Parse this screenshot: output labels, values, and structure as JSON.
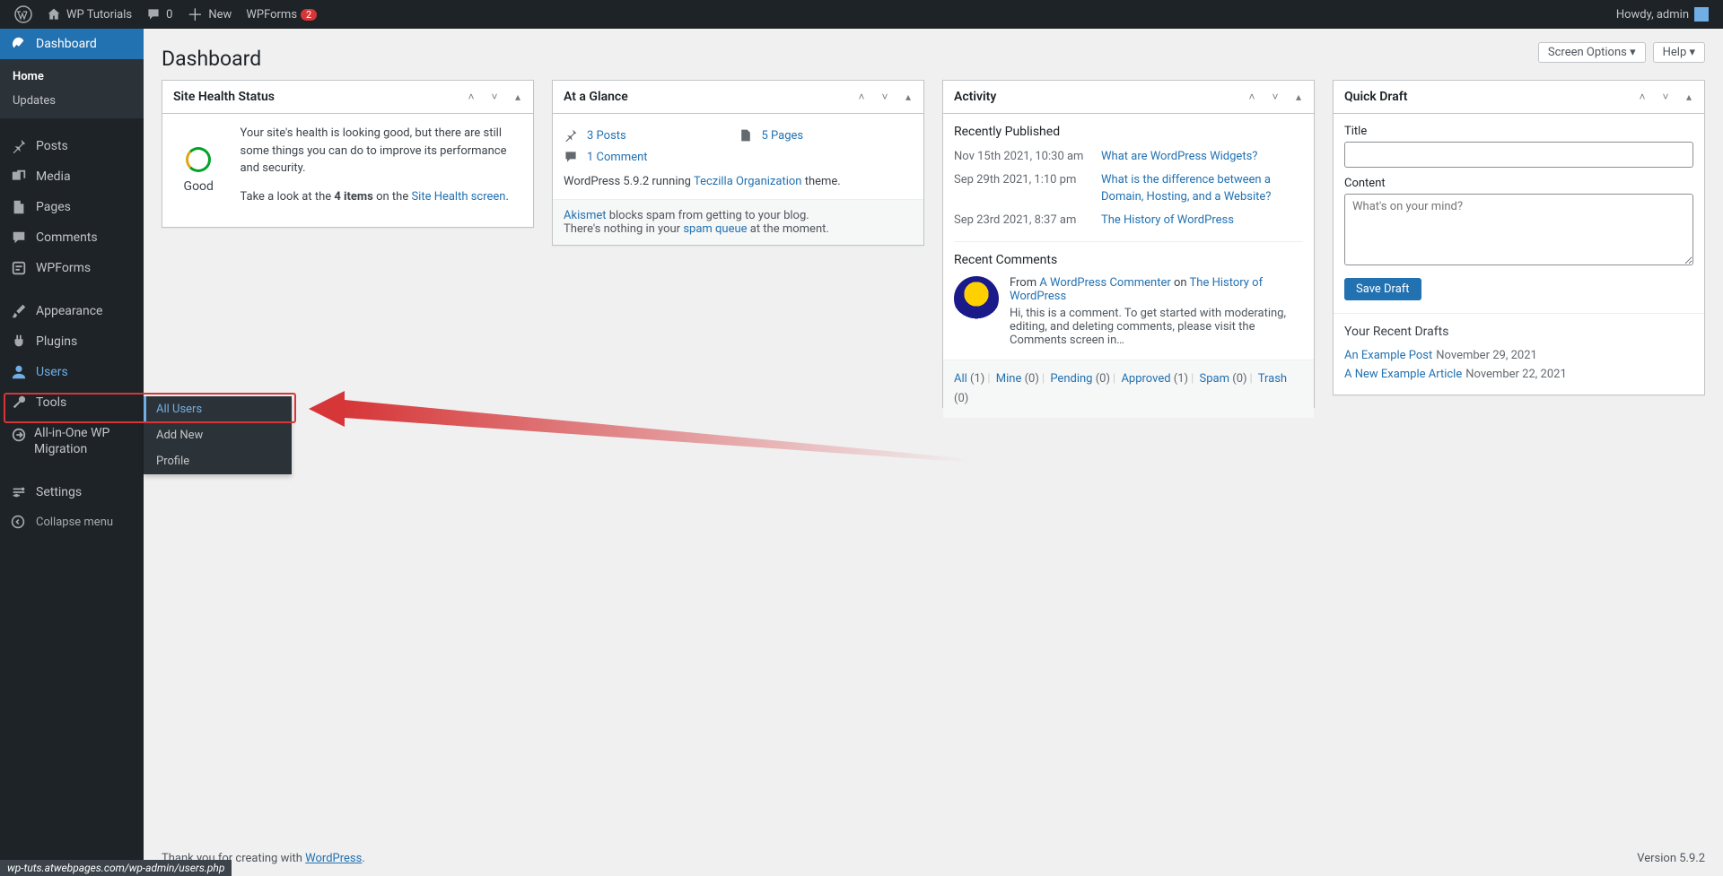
{
  "adminbar": {
    "site_name": "WP Tutorials",
    "comments_count": "0",
    "new_label": "New",
    "wpforms_label": "WPForms",
    "wpforms_badge": "2",
    "howdy": "Howdy, admin"
  },
  "sidebar": {
    "dashboard": "Dashboard",
    "sub_home": "Home",
    "sub_updates": "Updates",
    "posts": "Posts",
    "media": "Media",
    "pages": "Pages",
    "comments": "Comments",
    "wpforms": "WPForms",
    "appearance": "Appearance",
    "plugins": "Plugins",
    "users": "Users",
    "tools": "Tools",
    "aio": "All-in-One WP Migration",
    "settings": "Settings",
    "collapse": "Collapse menu"
  },
  "users_flyout": {
    "all_users": "All Users",
    "add_new": "Add New",
    "profile": "Profile"
  },
  "page": {
    "title": "Dashboard",
    "screen_options": "Screen Options ▾",
    "help": "Help ▾"
  },
  "site_health": {
    "widget_title": "Site Health Status",
    "status_label": "Good",
    "p1": "Your site's health is looking good, but there are still some things you can do to improve its performance and security.",
    "p2a": "Take a look at the ",
    "p2b": "4 items",
    "p2c": " on the ",
    "p2d": "Site Health screen",
    "p2e": "."
  },
  "glance": {
    "widget_title": "At a Glance",
    "posts_count": "3 Posts",
    "pages_count": "5 Pages",
    "comments_count": "1 Comment",
    "version_a": "WordPress 5.9.2 running ",
    "version_theme": "Teczilla Organization",
    "version_b": " theme.",
    "akismet_a": "Akismet",
    "akismet_b": " blocks spam from getting to your blog.",
    "akismet_c": "There's nothing in your ",
    "akismet_d": "spam queue",
    "akismet_e": " at the moment."
  },
  "activity": {
    "widget_title": "Activity",
    "recently_published": "Recently Published",
    "posts": [
      {
        "date": "Nov 15th 2021, 10:30 am",
        "title": "What are WordPress Widgets?"
      },
      {
        "date": "Sep 29th 2021, 1:10 pm",
        "title": "What is the difference between a Domain, Hosting, and a Website?"
      },
      {
        "date": "Sep 23rd 2021, 8:37 am",
        "title": "The History of WordPress"
      }
    ],
    "recent_comments": "Recent Comments",
    "comment_from": "From ",
    "comment_author": "A WordPress Commenter",
    "comment_on": " on ",
    "comment_post": "The History of WordPress",
    "comment_text": "Hi, this is a comment. To get started with moderating, editing, and deleting comments, please visit the Comments screen in…",
    "filters": {
      "all": "All",
      "all_n": "(1)",
      "mine": "Mine",
      "mine_n": "(0)",
      "pending": "Pending",
      "pending_n": "(0)",
      "approved": "Approved",
      "approved_n": "(1)",
      "spam": "Spam",
      "spam_n": "(0)",
      "trash": "Trash",
      "trash_n": "(0)"
    }
  },
  "quick_draft": {
    "widget_title": "Quick Draft",
    "title_label": "Title",
    "content_label": "Content",
    "content_placeholder": "What's on your mind?",
    "save_btn": "Save Draft",
    "recent_drafts": "Your Recent Drafts",
    "drafts": [
      {
        "title": "An Example Post",
        "date": "November 29, 2021"
      },
      {
        "title": "A New Example Article",
        "date": "November 22, 2021"
      }
    ]
  },
  "footer": {
    "thank_a": "Thank you for creating with ",
    "thank_b": "WordPress",
    "thank_c": ".",
    "version": "Version 5.9.2"
  },
  "status_url": "wp-tut​s.atwebpages.com/wp-admin/users.php"
}
